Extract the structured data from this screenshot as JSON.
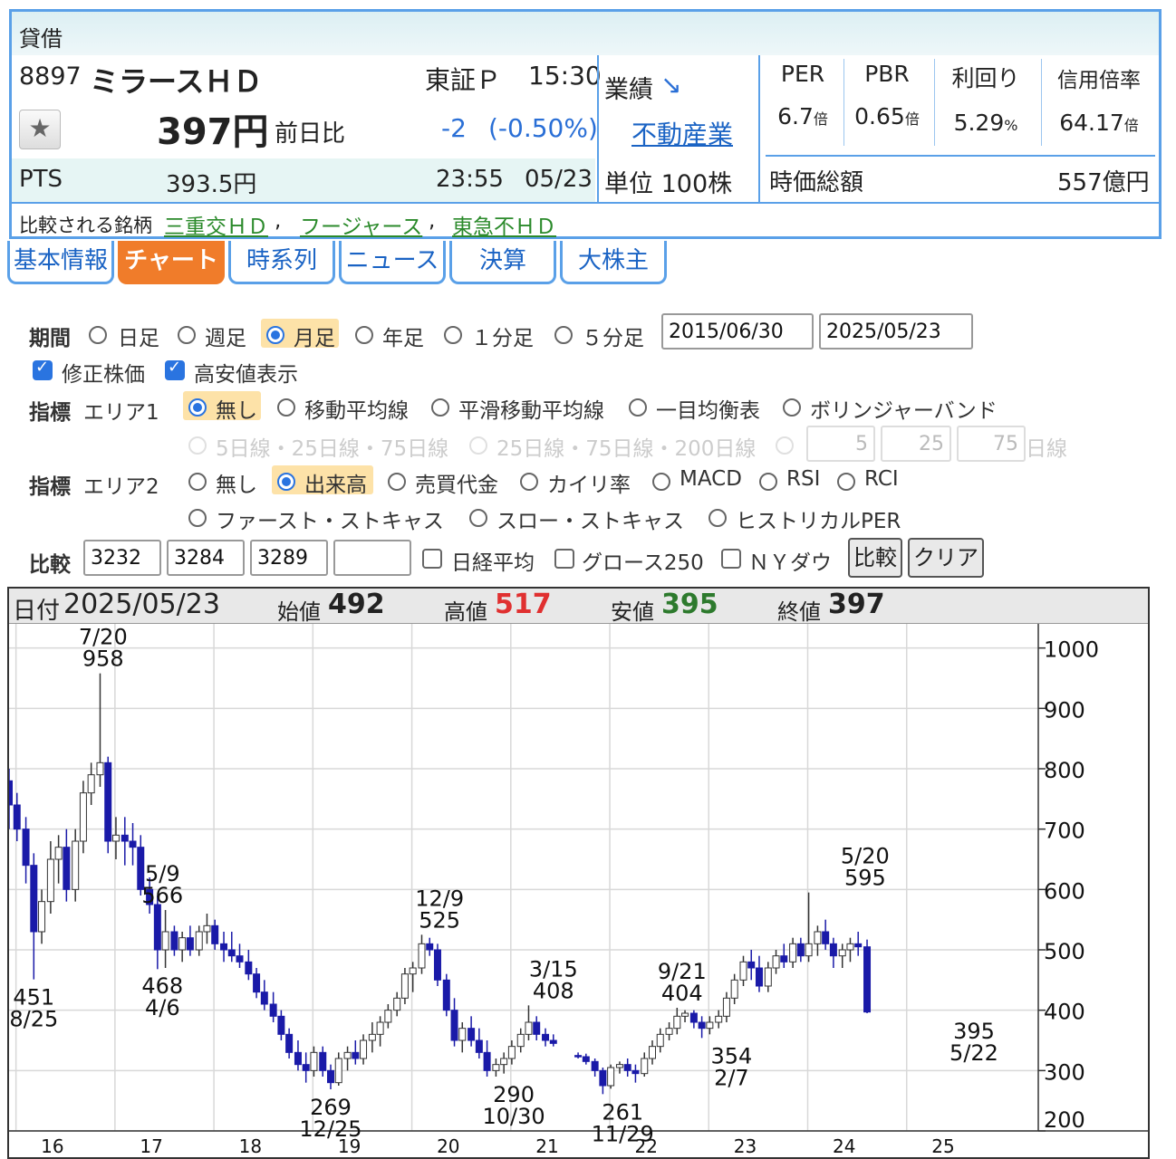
{
  "quote": {
    "tag": "貸借",
    "code": "8897",
    "name": "ミラースＨＤ",
    "market": "東証Ｐ",
    "time": "15:30",
    "price": "397円",
    "change_label": "前日比",
    "change": "-2",
    "change_pct": "(-0.50%)",
    "pts_label": "PTS",
    "pts_price": "393.5円",
    "pts_time": "23:55",
    "pts_date": "05/23",
    "earnings_label": "業績",
    "sector": "不動産業",
    "unit": "単位 100株",
    "stats": [
      {
        "label": "PER",
        "value": "6.7",
        "unit": "倍"
      },
      {
        "label": "PBR",
        "value": "0.65",
        "unit": "倍"
      },
      {
        "label": "利回り",
        "value": "5.29",
        "unit": "%"
      },
      {
        "label": "信用倍率",
        "value": "64.17",
        "unit": "倍"
      }
    ],
    "mcap_label": "時価総額",
    "mcap": "557億円",
    "compare_label": "比較される銘柄",
    "compare": [
      "三重交ＨＤ",
      "フージャース",
      "東急不ＨＤ"
    ],
    "compare_sep": ",",
    "accent": "#5aa0e8"
  },
  "tabs": [
    "基本情報",
    "チャート",
    "時系列",
    "ニュース",
    "決算",
    "大株主"
  ],
  "form": {
    "period_label": "期間",
    "periods": [
      "日足",
      "週足",
      "月足",
      "年足",
      "１分足",
      "５分足"
    ],
    "date_from": "2015/06/30",
    "date_to": "2025/05/23",
    "adjusted": "修正株価",
    "highlow": "高安値表示",
    "ind_label": "指標",
    "area1": "エリア1",
    "area1_opts": [
      "無し",
      "移動平均線",
      "平滑移動平均線",
      "一目均衡表",
      "ボリンジャーバンド"
    ],
    "ma_opts": [
      "5日線・25日線・75日線",
      "25日線・75日線・200日線"
    ],
    "ma_vals": [
      "5",
      "25",
      "75"
    ],
    "ma_unit": "日線",
    "area2": "エリア2",
    "area2_opts": [
      "無し",
      "出来高",
      "売買代金",
      "カイリ率",
      "MACD",
      "RSI",
      "RCI",
      "ファースト・ストキャス",
      "スロー・ストキャス",
      "ヒストリカルPER"
    ],
    "cmp_label": "比較",
    "cmp_codes": [
      "3232",
      "3284",
      "3289",
      ""
    ],
    "cmp_checks": [
      "日経平均",
      "グロース250",
      "ＮＹダウ"
    ],
    "btn_compare": "比較",
    "btn_clear": "クリア"
  },
  "chart_bar": {
    "date_label": "日付",
    "date": "2025/05/23",
    "open_label": "始値",
    "open": "492",
    "high_label": "高値",
    "high": "517",
    "low_label": "安値",
    "low": "395",
    "close_label": "終値",
    "close": "397",
    "high_color": "#e03030",
    "low_color": "#2d7a2d"
  },
  "chart_data": {
    "type": "candlestick",
    "ylim": [
      200,
      1040
    ],
    "yticks": [
      200,
      300,
      400,
      500,
      600,
      700,
      800,
      900,
      1000
    ],
    "xlim": [
      15.55,
      25.95
    ],
    "xticks": [
      {
        "x": 16,
        "label": "16"
      },
      {
        "x": 17,
        "label": "17"
      },
      {
        "x": 18,
        "label": "18"
      },
      {
        "x": 19,
        "label": "19"
      },
      {
        "x": 20,
        "label": "20"
      },
      {
        "x": 21,
        "label": "21"
      },
      {
        "x": 22,
        "label": "22"
      },
      {
        "x": 23,
        "label": "23"
      },
      {
        "x": 24,
        "label": "24"
      },
      {
        "x": 25,
        "label": "25"
      }
    ],
    "up_color": "#ffffff",
    "down_color": "#1a1aa8",
    "grid": true,
    "annotations": [
      {
        "date": "7/20",
        "value": "958",
        "x": 16.5,
        "y": 958,
        "pos": "above"
      },
      {
        "date": "8/25",
        "value": "451",
        "x": 15.8,
        "y": 451,
        "pos": "below"
      },
      {
        "date": "5/9",
        "value": "566",
        "x": 17.1,
        "y": 566,
        "pos": "above"
      },
      {
        "date": "4/6",
        "value": "468",
        "x": 17.1,
        "y": 470,
        "pos": "below"
      },
      {
        "date": "12/9",
        "value": "525",
        "x": 19.9,
        "y": 525,
        "pos": "above"
      },
      {
        "date": "12/25",
        "value": "269",
        "x": 18.8,
        "y": 269,
        "pos": "below"
      },
      {
        "date": "10/30",
        "value": "290",
        "x": 20.65,
        "y": 290,
        "pos": "below"
      },
      {
        "date": "3/15",
        "value": "408",
        "x": 21.05,
        "y": 408,
        "pos": "above"
      },
      {
        "date": "11/29",
        "value": "261",
        "x": 21.75,
        "y": 261,
        "pos": "below"
      },
      {
        "date": "9/21",
        "value": "404",
        "x": 22.35,
        "y": 404,
        "pos": "above"
      },
      {
        "date": "2/7",
        "value": "354",
        "x": 22.85,
        "y": 354,
        "pos": "below"
      },
      {
        "date": "5/20",
        "value": "595",
        "x": 24.2,
        "y": 595,
        "pos": "above"
      },
      {
        "date": "5/22",
        "value": "395",
        "x": 25.3,
        "y": 395,
        "pos": "below"
      }
    ],
    "candles": [
      [
        15.55,
        780,
        800,
        700,
        740
      ],
      [
        15.63,
        740,
        760,
        680,
        700
      ],
      [
        15.72,
        700,
        720,
        610,
        640
      ],
      [
        15.8,
        640,
        660,
        451,
        530
      ],
      [
        15.88,
        530,
        600,
        510,
        580
      ],
      [
        15.97,
        580,
        680,
        560,
        650
      ],
      [
        16.05,
        650,
        690,
        610,
        670
      ],
      [
        16.13,
        670,
        700,
        580,
        600
      ],
      [
        16.22,
        600,
        700,
        580,
        680
      ],
      [
        16.3,
        680,
        780,
        660,
        760
      ],
      [
        16.38,
        760,
        810,
        740,
        790
      ],
      [
        16.47,
        790,
        958,
        770,
        810
      ],
      [
        16.55,
        810,
        820,
        660,
        680
      ],
      [
        16.63,
        680,
        720,
        650,
        690
      ],
      [
        16.72,
        690,
        720,
        640,
        680
      ],
      [
        16.8,
        680,
        710,
        640,
        670
      ],
      [
        16.88,
        670,
        690,
        590,
        600
      ],
      [
        16.97,
        600,
        620,
        560,
        575
      ],
      [
        17.05,
        575,
        590,
        468,
        500
      ],
      [
        17.13,
        500,
        566,
        470,
        530
      ],
      [
        17.22,
        530,
        540,
        490,
        500
      ],
      [
        17.3,
        500,
        530,
        480,
        520
      ],
      [
        17.38,
        520,
        540,
        490,
        500
      ],
      [
        17.47,
        500,
        540,
        490,
        530
      ],
      [
        17.55,
        530,
        560,
        510,
        540
      ],
      [
        17.63,
        540,
        550,
        500,
        510
      ],
      [
        17.72,
        510,
        530,
        480,
        500
      ],
      [
        17.8,
        500,
        530,
        480,
        490
      ],
      [
        17.88,
        490,
        510,
        470,
        480
      ],
      [
        17.97,
        480,
        500,
        450,
        460
      ],
      [
        18.05,
        460,
        470,
        420,
        430
      ],
      [
        18.13,
        430,
        450,
        400,
        410
      ],
      [
        18.22,
        410,
        430,
        380,
        390
      ],
      [
        18.3,
        390,
        400,
        350,
        360
      ],
      [
        18.38,
        360,
        370,
        320,
        330
      ],
      [
        18.47,
        330,
        350,
        300,
        310
      ],
      [
        18.55,
        310,
        330,
        280,
        300
      ],
      [
        18.63,
        300,
        340,
        290,
        330
      ],
      [
        18.72,
        330,
        340,
        290,
        300
      ],
      [
        18.8,
        300,
        310,
        269,
        280
      ],
      [
        18.88,
        280,
        330,
        275,
        320
      ],
      [
        18.97,
        320,
        340,
        300,
        330
      ],
      [
        19.05,
        330,
        350,
        310,
        320
      ],
      [
        19.13,
        320,
        360,
        310,
        350
      ],
      [
        19.22,
        350,
        380,
        330,
        360
      ],
      [
        19.3,
        360,
        390,
        340,
        380
      ],
      [
        19.38,
        380,
        410,
        370,
        400
      ],
      [
        19.47,
        400,
        430,
        390,
        420
      ],
      [
        19.55,
        420,
        470,
        410,
        460
      ],
      [
        19.63,
        460,
        480,
        430,
        470
      ],
      [
        19.72,
        470,
        525,
        460,
        510
      ],
      [
        19.8,
        510,
        520,
        490,
        500
      ],
      [
        19.88,
        500,
        510,
        440,
        450
      ],
      [
        19.97,
        450,
        460,
        390,
        400
      ],
      [
        20.05,
        400,
        420,
        340,
        350
      ],
      [
        20.13,
        350,
        380,
        330,
        370
      ],
      [
        20.22,
        370,
        390,
        340,
        350
      ],
      [
        20.3,
        350,
        370,
        320,
        330
      ],
      [
        20.38,
        330,
        350,
        290,
        300
      ],
      [
        20.47,
        300,
        320,
        290,
        310
      ],
      [
        20.55,
        310,
        330,
        295,
        320
      ],
      [
        20.63,
        320,
        350,
        310,
        340
      ],
      [
        20.72,
        340,
        370,
        330,
        360
      ],
      [
        20.8,
        360,
        408,
        350,
        380
      ],
      [
        20.88,
        380,
        390,
        350,
        360
      ],
      [
        20.97,
        360,
        370,
        340,
        350
      ],
      [
        21.05,
        350,
        360,
        340,
        345
      ],
      [
        21.3,
        325,
        330,
        320,
        323
      ],
      [
        21.38,
        323,
        328,
        310,
        315
      ],
      [
        21.47,
        315,
        320,
        290,
        300
      ],
      [
        21.55,
        300,
        305,
        261,
        275
      ],
      [
        21.63,
        275,
        310,
        270,
        305
      ],
      [
        21.72,
        305,
        315,
        295,
        310
      ],
      [
        21.8,
        310,
        320,
        290,
        300
      ],
      [
        21.88,
        300,
        310,
        280,
        295
      ],
      [
        21.97,
        295,
        330,
        290,
        320
      ],
      [
        22.05,
        320,
        350,
        310,
        340
      ],
      [
        22.13,
        340,
        370,
        330,
        360
      ],
      [
        22.22,
        360,
        380,
        350,
        370
      ],
      [
        22.3,
        370,
        404,
        360,
        390
      ],
      [
        22.38,
        390,
        400,
        380,
        395
      ],
      [
        22.47,
        395,
        400,
        370,
        380
      ],
      [
        22.55,
        380,
        390,
        354,
        370
      ],
      [
        22.63,
        370,
        390,
        360,
        380
      ],
      [
        22.72,
        380,
        400,
        370,
        390
      ],
      [
        22.8,
        390,
        430,
        380,
        420
      ],
      [
        22.88,
        420,
        460,
        410,
        450
      ],
      [
        22.97,
        450,
        490,
        440,
        480
      ],
      [
        23.05,
        480,
        500,
        450,
        470
      ],
      [
        23.13,
        470,
        490,
        430,
        440
      ],
      [
        23.22,
        440,
        480,
        430,
        470
      ],
      [
        23.3,
        470,
        500,
        460,
        490
      ],
      [
        23.38,
        490,
        510,
        470,
        480
      ],
      [
        23.47,
        480,
        520,
        470,
        510
      ],
      [
        23.55,
        510,
        520,
        480,
        490
      ],
      [
        23.63,
        490,
        595,
        480,
        510
      ],
      [
        23.72,
        510,
        540,
        490,
        530
      ],
      [
        23.8,
        530,
        550,
        500,
        510
      ],
      [
        23.88,
        510,
        520,
        470,
        490
      ],
      [
        23.97,
        490,
        510,
        470,
        500
      ],
      [
        24.05,
        500,
        520,
        480,
        510
      ],
      [
        24.13,
        510,
        530,
        490,
        505
      ],
      [
        24.22,
        505,
        517,
        395,
        397
      ]
    ]
  }
}
